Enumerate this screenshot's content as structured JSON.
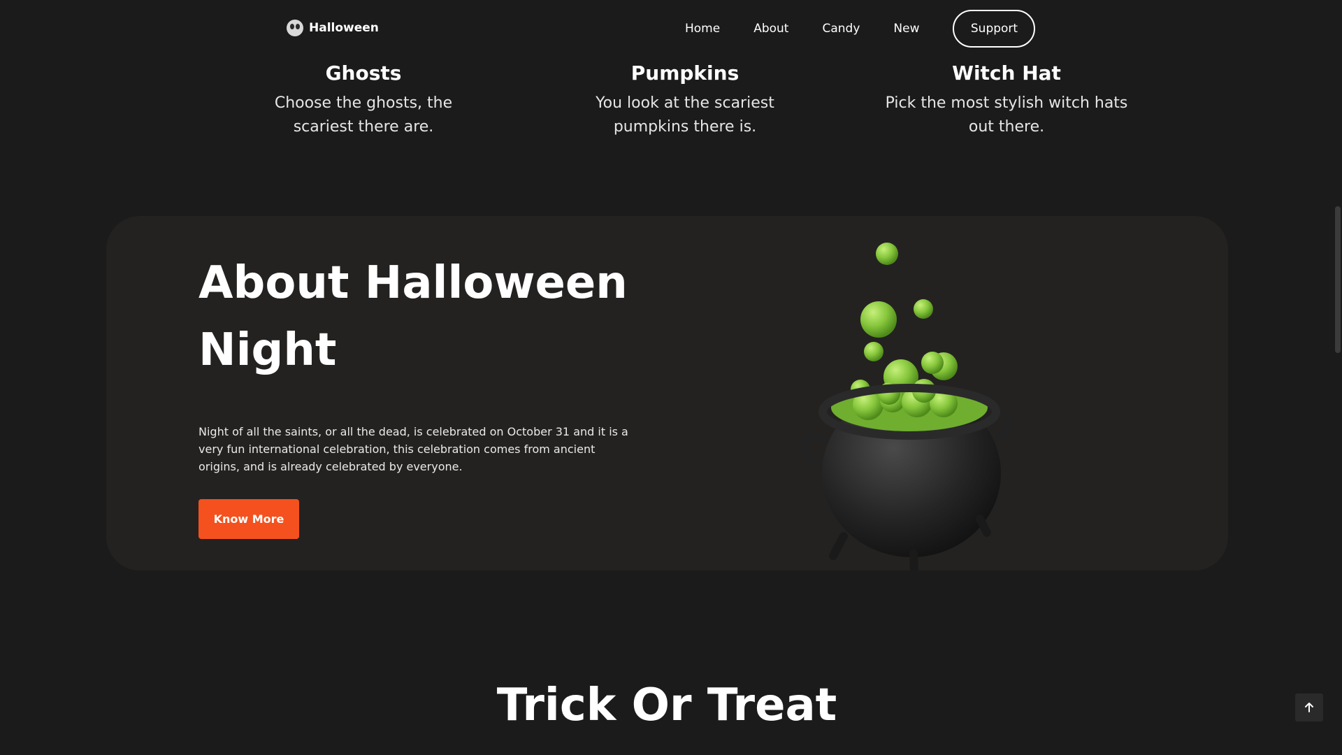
{
  "header": {
    "logo_text": "Halloween",
    "nav": [
      {
        "label": "Home"
      },
      {
        "label": "About"
      },
      {
        "label": "Candy"
      },
      {
        "label": "New"
      }
    ],
    "support_label": "Support"
  },
  "features": [
    {
      "title": "Ghosts",
      "line1": "Choose the ghosts, the",
      "line2": "scariest there are."
    },
    {
      "title": "Pumpkins",
      "line1": "You look at the scariest",
      "line2": "pumpkins there is."
    },
    {
      "title": "Witch Hat",
      "line1": "Pick the most stylish witch hats",
      "line2": "out there."
    }
  ],
  "about": {
    "title_line1": "About Halloween",
    "title_line2": "Night",
    "text": "Night of all the saints, or all the dead, is celebrated on October 31 and it is a very fun international celebration, this celebration comes from ancient origins, and is already celebrated by everyone.",
    "button_label": "Know More"
  },
  "trick": {
    "title": "Trick Or Treat"
  },
  "colors": {
    "background": "#1b1b1b",
    "card": "#242220",
    "accent": "#f4511e",
    "potion": "#8bc34a"
  },
  "icons": {
    "logo": "skull-icon",
    "scroll_top": "arrow-up-icon"
  }
}
